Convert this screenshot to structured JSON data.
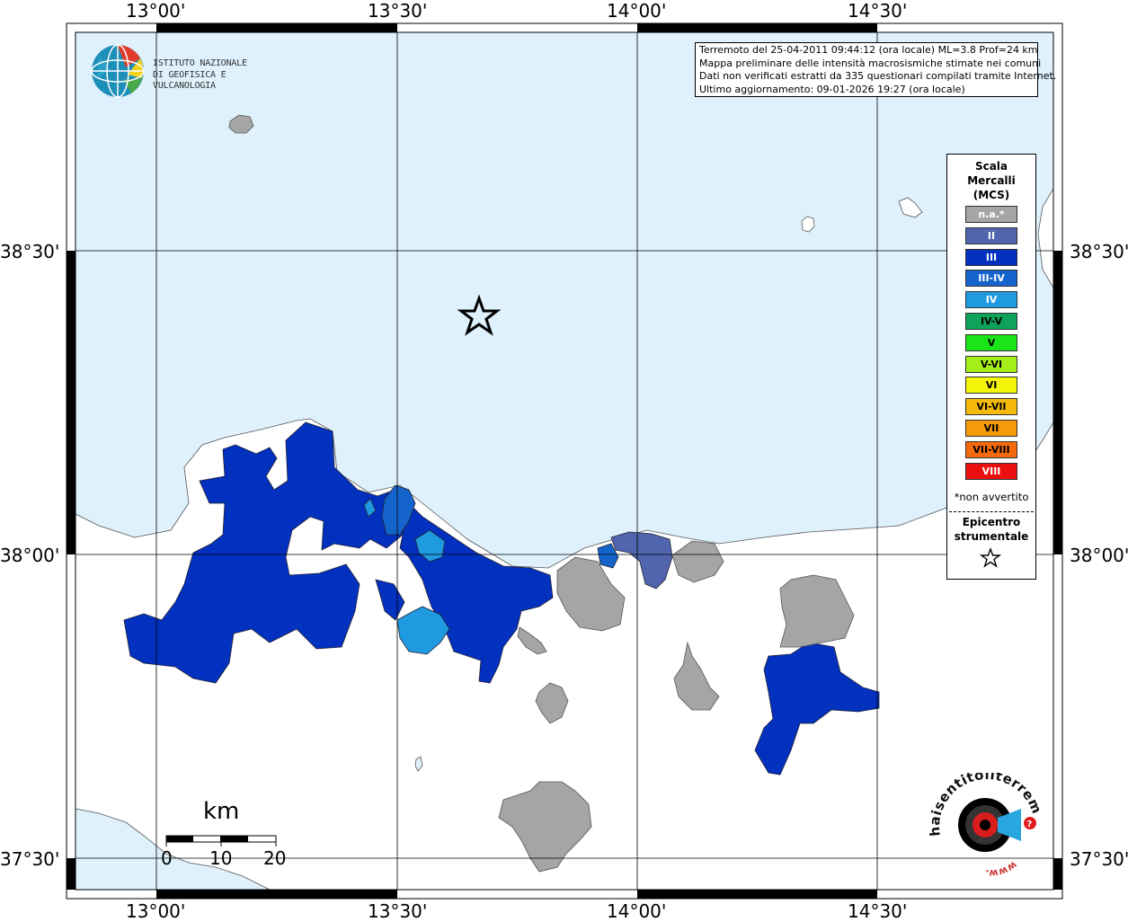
{
  "map": {
    "lon_ticks": [
      "13°00'",
      "13°30'",
      "14°00'",
      "14°30'"
    ],
    "lat_ticks": [
      "38°30'",
      "38°00'",
      "37°30'"
    ],
    "colors": {
      "sea": "#def1fc",
      "land": "#ffffff",
      "na": "#a5a5a5",
      "II": "#5065ad",
      "III": "#0231bf",
      "III-IV": "#1464cb",
      "IV": "#1f9ae1"
    }
  },
  "logo_ingv": {
    "line1": "ISTITUTO NAZIONALE",
    "line2": "DI GEOFISICA E VULCANOLOGIA"
  },
  "info": {
    "line1": "Terremoto del 25-04-2011 09:44:12 (ora locale) ML=3.8 Prof=24 km",
    "line2": "Mappa preliminare delle intensità macrosismiche stimate nei comuni",
    "line3": "Dati non verificati estratti da 335 questionari compilati tramite Internet.",
    "line4": "Ultimo aggiornamento: 09-01-2026 19:27 (ora locale)"
  },
  "legend": {
    "title_line1": "Scala",
    "title_line2": "Mercalli",
    "title_line3": "(MCS)",
    "items": [
      {
        "label": "n.a.*",
        "color": "#a5a5a5",
        "text_color": "#ffffff"
      },
      {
        "label": "II",
        "color": "#5065ad",
        "text_color": "#ffffff"
      },
      {
        "label": "III",
        "color": "#0231bf",
        "text_color": "#ffffff"
      },
      {
        "label": "III-IV",
        "color": "#1464cb",
        "text_color": "#ffffff"
      },
      {
        "label": "IV",
        "color": "#1f9ae1",
        "text_color": "#ffffff"
      },
      {
        "label": "IV-V",
        "color": "#0ea35a",
        "text_color": "#000000"
      },
      {
        "label": "V",
        "color": "#19e519",
        "text_color": "#000000"
      },
      {
        "label": "V-VI",
        "color": "#a4ef19",
        "text_color": "#000000"
      },
      {
        "label": "VI",
        "color": "#f5f50a",
        "text_color": "#000000"
      },
      {
        "label": "VI-VII",
        "color": "#f5b90a",
        "text_color": "#000000"
      },
      {
        "label": "VII",
        "color": "#f59a0a",
        "text_color": "#000000"
      },
      {
        "label": "VII-VIII",
        "color": "#f56a0a",
        "text_color": "#000000"
      },
      {
        "label": "VIII",
        "color": "#eb1010",
        "text_color": "#ffffff"
      }
    ],
    "note": "*non avvertito",
    "epicenter_line1": "Epicentro",
    "epicenter_line2": "strumentale"
  },
  "scale": {
    "unit": "km",
    "labels": [
      "0",
      "10",
      "20"
    ]
  },
  "hst_logo": {
    "text": "haisentitoilterremoto.it",
    "prefix": "www."
  }
}
